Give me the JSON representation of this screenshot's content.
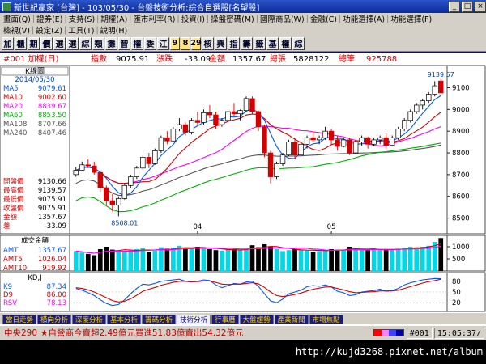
{
  "window": {
    "title": "新世紀贏家 [台灣] - 103/05/30 - 台盤技術分析:綜合自選股[名望股]",
    "btn_min": "_",
    "btn_max": "□",
    "btn_close": "×"
  },
  "menubar_row1": [
    "畫面(Q)",
    "證券(E)",
    "支持(S)",
    "期權(A)",
    "匯市利率(R)",
    "投資(I)",
    "操盤密碼(M)",
    "國際商品(W)",
    "金融(C)",
    "功能選擇(A)",
    "功能選擇(F)"
  ],
  "menubar_row2": [
    "檢視(V)",
    "設定(Z)",
    "工具(T)",
    "說明(H)"
  ],
  "toolbar": [
    "加",
    "櫃",
    "期",
    "價",
    "選",
    "選",
    "綜",
    "類",
    "攤",
    "智",
    "權",
    "委",
    "江",
    "9",
    "8",
    "29",
    "核",
    "興",
    "指",
    "籌",
    "籤",
    "基",
    "權",
    "綜"
  ],
  "header": {
    "code": "#001 加權(日)",
    "index_label": "指數",
    "index_value": "9075.91",
    "chg_label": "漲跌",
    "chg_value": "-33.09",
    "amount_label": "金額",
    "amount_value": "1357.67",
    "total_label": "總張",
    "total_value": "5828122",
    "volume_label": "總筆",
    "volume_value": "925788"
  },
  "left_panel": {
    "title": "K線圖",
    "date": "2014/05/30",
    "ma": [
      {
        "label": "MA5",
        "value": "9079.61",
        "color": "#0055ff"
      },
      {
        "label": "MA10",
        "value": "9002.60",
        "color": "#d40000"
      },
      {
        "label": "MA20",
        "value": "8839.67",
        "color": "#ff00ff"
      },
      {
        "label": "MA60",
        "value": "8853.50",
        "color": "#00b000"
      },
      {
        "label": "MA108",
        "value": "8707.66",
        "color": "#555555"
      },
      {
        "label": "MA240",
        "value": "8407.46",
        "color": "#555555"
      }
    ],
    "prices": [
      {
        "label": "開盤價",
        "value": "9130.66"
      },
      {
        "label": "最高價",
        "value": "9139.57"
      },
      {
        "label": "最低價",
        "value": "9075.91"
      },
      {
        "label": "收盤價",
        "value": "9075.91"
      },
      {
        "label": "金額",
        "value": "1357.67"
      },
      {
        "label": "差",
        "value": "-33.09"
      }
    ],
    "volume_title": "成交金額",
    "vol_items": [
      {
        "label": "AMT",
        "value": "1357.67",
        "color": "#0055ff"
      },
      {
        "label": "AMT5",
        "value": "1026.04",
        "color": "#d40000"
      },
      {
        "label": "AMT10",
        "value": "919.92",
        "color": "#d40000"
      }
    ],
    "kd_title": "KD,J",
    "kd_items": [
      {
        "label": "K9",
        "value": "87.34",
        "color": "#0055ff"
      },
      {
        "label": "D9",
        "value": "86.00",
        "color": "#d40000"
      },
      {
        "label": "RSV",
        "value": "78.13",
        "color": "#ff00ff"
      }
    ]
  },
  "chart_data": [
    {
      "type": "candlestick",
      "title": "",
      "x_ticks": [
        {
          "index": 20,
          "label": "04"
        },
        {
          "index": 42,
          "label": "05"
        }
      ],
      "ylim": [
        8450,
        9180
      ],
      "y_ticks": [
        8500,
        8600,
        8700,
        8800,
        8900,
        9000,
        9100
      ],
      "annotations": [
        {
          "text": "9139.57",
          "index": 60,
          "value": 9139.57
        },
        {
          "text": "8508.01",
          "index": 8,
          "value": 8508.01
        }
      ],
      "candles": [
        {
          "o": 8700,
          "h": 8735,
          "l": 8690,
          "c": 8720
        },
        {
          "o": 8720,
          "h": 8760,
          "l": 8715,
          "c": 8745
        },
        {
          "o": 8745,
          "h": 8770,
          "l": 8730,
          "c": 8740
        },
        {
          "o": 8740,
          "h": 8760,
          "l": 8700,
          "c": 8710
        },
        {
          "o": 8710,
          "h": 8720,
          "l": 8620,
          "c": 8640
        },
        {
          "o": 8640,
          "h": 8650,
          "l": 8560,
          "c": 8580
        },
        {
          "o": 8580,
          "h": 8610,
          "l": 8530,
          "c": 8560
        },
        {
          "o": 8560,
          "h": 8600,
          "l": 8508,
          "c": 8590
        },
        {
          "o": 8590,
          "h": 8660,
          "l": 8585,
          "c": 8650
        },
        {
          "o": 8650,
          "h": 8700,
          "l": 8640,
          "c": 8690
        },
        {
          "o": 8690,
          "h": 8740,
          "l": 8680,
          "c": 8730
        },
        {
          "o": 8730,
          "h": 8790,
          "l": 8720,
          "c": 8780
        },
        {
          "o": 8780,
          "h": 8800,
          "l": 8730,
          "c": 8750
        },
        {
          "o": 8750,
          "h": 8820,
          "l": 8745,
          "c": 8810
        },
        {
          "o": 8810,
          "h": 8880,
          "l": 8800,
          "c": 8870
        },
        {
          "o": 8870,
          "h": 8900,
          "l": 8840,
          "c": 8855
        },
        {
          "o": 8855,
          "h": 8920,
          "l": 8850,
          "c": 8910
        },
        {
          "o": 8910,
          "h": 8960,
          "l": 8900,
          "c": 8930
        },
        {
          "o": 8930,
          "h": 8940,
          "l": 8880,
          "c": 8895
        },
        {
          "o": 8895,
          "h": 8960,
          "l": 8885,
          "c": 8950
        },
        {
          "o": 8950,
          "h": 8990,
          "l": 8930,
          "c": 8940
        },
        {
          "o": 8940,
          "h": 9000,
          "l": 8930,
          "c": 8985
        },
        {
          "o": 8985,
          "h": 9020,
          "l": 8960,
          "c": 8975
        },
        {
          "o": 8975,
          "h": 8990,
          "l": 8910,
          "c": 8930
        },
        {
          "o": 8930,
          "h": 8960,
          "l": 8920,
          "c": 8950
        },
        {
          "o": 8950,
          "h": 9000,
          "l": 8940,
          "c": 8990
        },
        {
          "o": 8990,
          "h": 9030,
          "l": 8970,
          "c": 8980
        },
        {
          "o": 8980,
          "h": 9000,
          "l": 8950,
          "c": 8995
        },
        {
          "o": 8995,
          "h": 9060,
          "l": 8990,
          "c": 9050
        },
        {
          "o": 9050,
          "h": 9060,
          "l": 8980,
          "c": 8990
        },
        {
          "o": 8990,
          "h": 8995,
          "l": 8900,
          "c": 8920
        },
        {
          "o": 8920,
          "h": 8930,
          "l": 8780,
          "c": 8800
        },
        {
          "o": 8800,
          "h": 8810,
          "l": 8660,
          "c": 8690
        },
        {
          "o": 8690,
          "h": 8760,
          "l": 8680,
          "c": 8750
        },
        {
          "o": 8750,
          "h": 8800,
          "l": 8740,
          "c": 8790
        },
        {
          "o": 8790,
          "h": 8860,
          "l": 8785,
          "c": 8850
        },
        {
          "o": 8850,
          "h": 8870,
          "l": 8770,
          "c": 8790
        },
        {
          "o": 8790,
          "h": 8860,
          "l": 8785,
          "c": 8840
        },
        {
          "o": 8840,
          "h": 8880,
          "l": 8820,
          "c": 8870
        },
        {
          "o": 8870,
          "h": 8900,
          "l": 8850,
          "c": 8860
        },
        {
          "o": 8860,
          "h": 8880,
          "l": 8840,
          "c": 8870
        },
        {
          "o": 8870,
          "h": 8920,
          "l": 8860,
          "c": 8900
        },
        {
          "o": 8900,
          "h": 8910,
          "l": 8840,
          "c": 8860
        },
        {
          "o": 8860,
          "h": 8880,
          "l": 8810,
          "c": 8830
        },
        {
          "o": 8830,
          "h": 8870,
          "l": 8825,
          "c": 8860
        },
        {
          "o": 8860,
          "h": 8870,
          "l": 8790,
          "c": 8800
        },
        {
          "o": 8800,
          "h": 8860,
          "l": 8795,
          "c": 8850
        },
        {
          "o": 8850,
          "h": 8880,
          "l": 8830,
          "c": 8870
        },
        {
          "o": 8870,
          "h": 8875,
          "l": 8820,
          "c": 8840
        },
        {
          "o": 8840,
          "h": 8870,
          "l": 8830,
          "c": 8860
        },
        {
          "o": 8860,
          "h": 8880,
          "l": 8840,
          "c": 8870
        },
        {
          "o": 8870,
          "h": 8890,
          "l": 8820,
          "c": 8835
        },
        {
          "o": 8835,
          "h": 8880,
          "l": 8830,
          "c": 8870
        },
        {
          "o": 8870,
          "h": 8920,
          "l": 8860,
          "c": 8910
        },
        {
          "o": 8910,
          "h": 8960,
          "l": 8900,
          "c": 8950
        },
        {
          "o": 8950,
          "h": 9000,
          "l": 8940,
          "c": 8990
        },
        {
          "o": 8990,
          "h": 9030,
          "l": 8980,
          "c": 9020
        },
        {
          "o": 9020,
          "h": 9050,
          "l": 9000,
          "c": 9040
        },
        {
          "o": 9040,
          "h": 9080,
          "l": 9030,
          "c": 9070
        },
        {
          "o": 9070,
          "h": 9130,
          "l": 9060,
          "c": 9109
        },
        {
          "o": 9130.66,
          "h": 9139.57,
          "l": 9075.91,
          "c": 9075.91
        }
      ]
    },
    {
      "type": "bar",
      "title": "成交金額",
      "ylim": [
        0,
        1400
      ],
      "y_ticks": [
        500,
        1000
      ],
      "values": [
        820,
        760,
        700,
        650,
        900,
        1000,
        880,
        780,
        820,
        860,
        900,
        950,
        780,
        840,
        980,
        920,
        960,
        1040,
        900,
        960,
        1000,
        950,
        900,
        860,
        840,
        880,
        900,
        860,
        920,
        1060,
        980,
        1100,
        1000,
        900,
        820,
        860,
        900,
        880,
        840,
        800,
        820,
        860,
        900,
        880,
        860,
        1000,
        920,
        880,
        860,
        900,
        880,
        860,
        900,
        920,
        940,
        1000,
        980,
        1000,
        1040,
        1200,
        1357.67
      ]
    },
    {
      "type": "line",
      "title": "KD,J",
      "ylim": [
        0,
        100
      ],
      "y_ticks": [
        20,
        50,
        80
      ],
      "series": [
        {
          "name": "K9",
          "color": "#0055ff",
          "values": [
            60,
            55,
            48,
            40,
            28,
            18,
            12,
            15,
            28,
            45,
            60,
            72,
            70,
            74,
            80,
            82,
            84,
            86,
            80,
            78,
            80,
            84,
            82,
            70,
            62,
            68,
            74,
            72,
            78,
            80,
            66,
            45,
            25,
            20,
            30,
            45,
            50,
            55,
            65,
            68,
            66,
            70,
            64,
            52,
            48,
            40,
            42,
            50,
            52,
            54,
            58,
            52,
            54,
            60,
            70,
            76,
            80,
            84,
            86,
            88,
            87.34
          ]
        },
        {
          "name": "D9",
          "color": "#d40000",
          "values": [
            62,
            60,
            56,
            50,
            42,
            34,
            26,
            22,
            24,
            31,
            41,
            52,
            58,
            63,
            69,
            73,
            77,
            80,
            80,
            79,
            79,
            81,
            81,
            77,
            72,
            71,
            72,
            72,
            74,
            76,
            73,
            63,
            50,
            40,
            37,
            40,
            43,
            47,
            53,
            58,
            61,
            64,
            64,
            60,
            56,
            51,
            48,
            49,
            50,
            51,
            53,
            53,
            53,
            55,
            60,
            65,
            70,
            75,
            79,
            82,
            86.0
          ]
        }
      ]
    }
  ],
  "tabs": [
    "當日走勢",
    "橫向分析",
    "深度分析",
    "基本分析",
    "籌碼分析",
    "技術分析",
    "行事曆",
    "大盤趨勢",
    "產業新聞",
    "市場焦點"
  ],
  "active_tab": 5,
  "status": {
    "name": "中央290",
    "star": "★自營商今賣超2.49億元",
    "msg": " 買進51.83億賣出54.32億元",
    "code": "#001",
    "time": "15:05:37/",
    "colors": [
      "#ff0000",
      "#ff80ff",
      "#4040ff",
      "#0000a0"
    ]
  },
  "url": "http://kujd3268.pixnet.net/album"
}
